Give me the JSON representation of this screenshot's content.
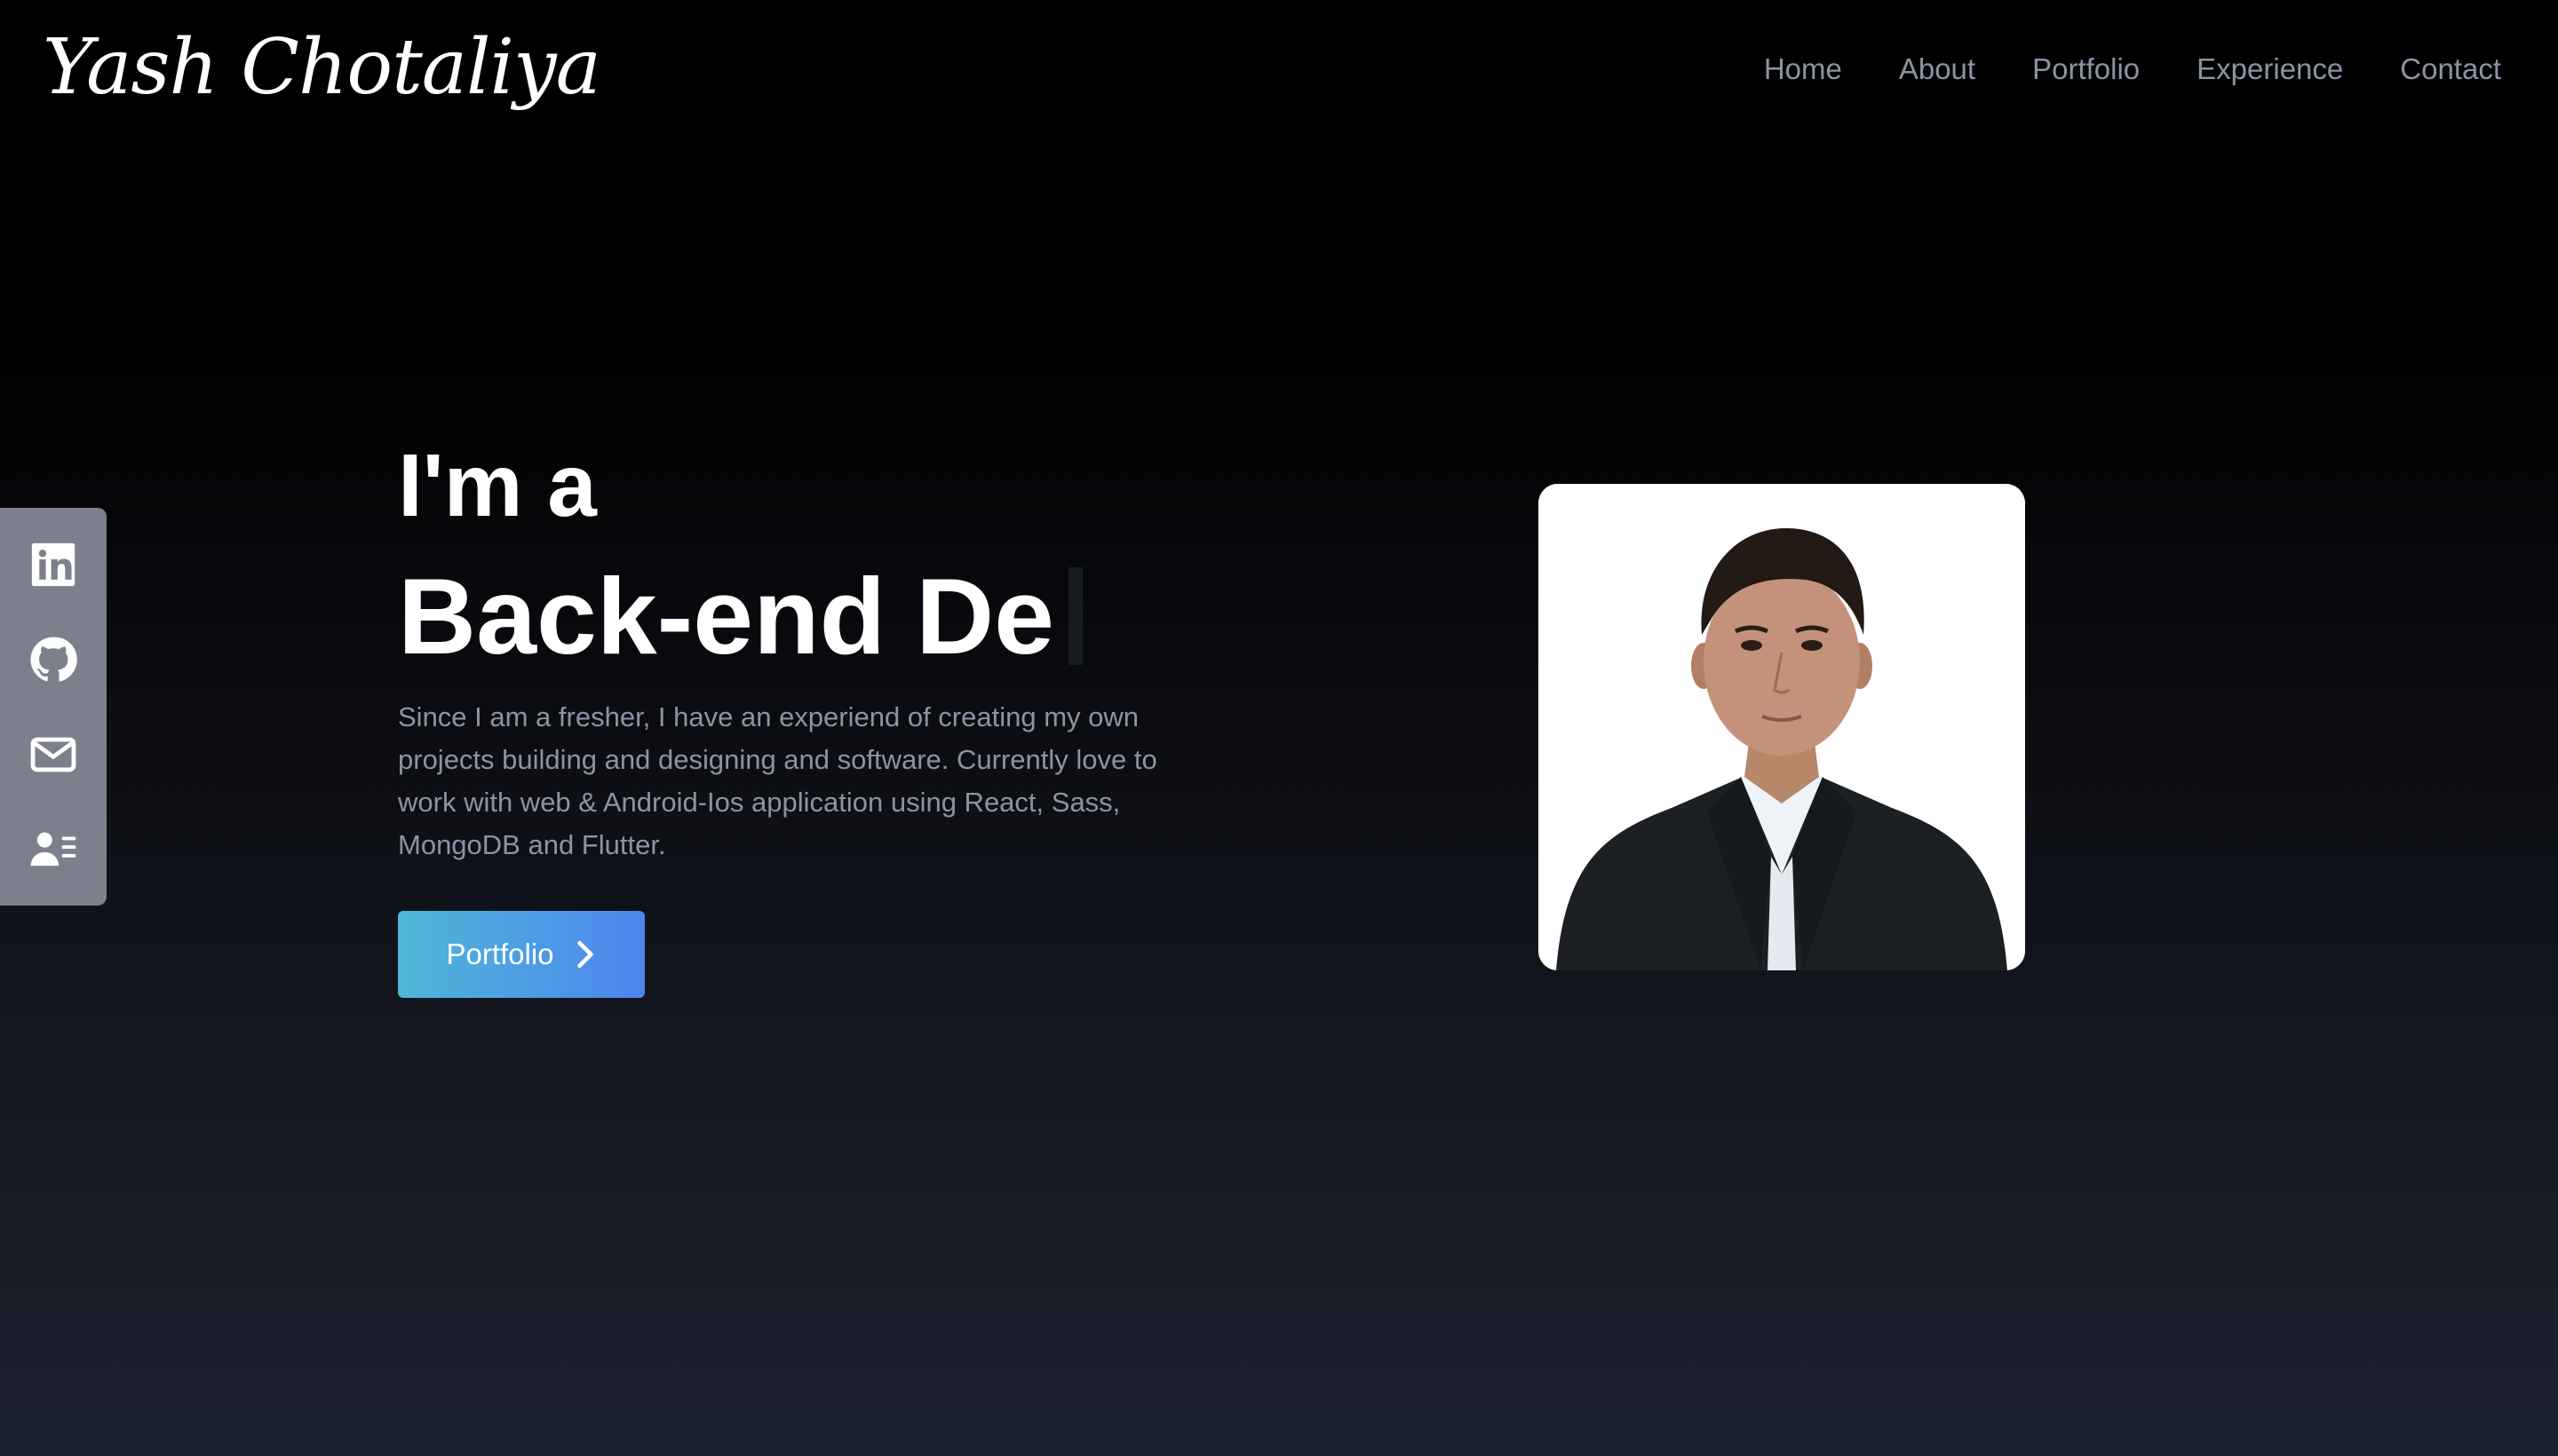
{
  "header": {
    "logo_text": "Yash Chotaliya",
    "nav": [
      {
        "label": "Home"
      },
      {
        "label": "About"
      },
      {
        "label": "Portfolio"
      },
      {
        "label": "Experience"
      },
      {
        "label": "Contact"
      }
    ]
  },
  "social": {
    "items": [
      {
        "icon": "linkedin-icon"
      },
      {
        "icon": "github-icon"
      },
      {
        "icon": "mail-icon"
      },
      {
        "icon": "resume-icon"
      }
    ]
  },
  "hero": {
    "intro": "I'm a",
    "role": "Back-end De",
    "description": "Since I am a fresher, I have an experiend of creating my own projects building and designing and software. Currently love to work with web & Android-Ios application using React, Sass, MongoDB and Flutter.",
    "cta_label": "Portfolio"
  },
  "colors": {
    "nav_text": "#8c93a4",
    "sidebar_bg": "#7b808c",
    "cta_gradient_start": "#4fb7d8",
    "cta_gradient_end": "#4c86ee"
  }
}
